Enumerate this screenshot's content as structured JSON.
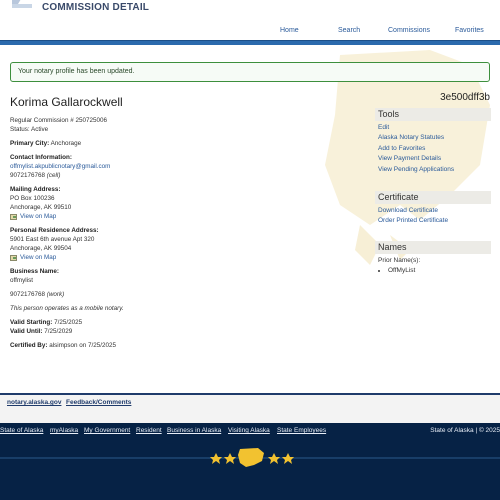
{
  "header": {
    "title": "COMMISSION DETAIL",
    "nav": [
      "Home",
      "Search",
      "Commissions",
      "Favorites"
    ]
  },
  "alert": "Your notary profile has been updated.",
  "notary": {
    "name": "Korima Gallarockwell",
    "hash": "3e500dff3b",
    "commission": "Regular Commission # 250725006",
    "status": "Status: Active",
    "primary_city_label": "Primary City:",
    "primary_city": "Anchorage",
    "contact_label": "Contact Information:",
    "email": "offmylist.akpublicnotary@gmail.com",
    "phone_cell": "9072176768",
    "cell_tag": "(cell)",
    "mailing_label": "Mailing Address:",
    "mailing_line1": "PO Box 100236",
    "mailing_line2": "Anchorage, AK 99510",
    "view_on_map": "View on Map",
    "residence_label": "Personal Residence Address:",
    "residence_line1": "5901 East 6th avenue Apt 320",
    "residence_line2": "Anchorage, AK 99504",
    "business_label": "Business Name:",
    "business_name": "offmylist",
    "phone_work": "9072176768",
    "work_tag": "(work)",
    "mobile_note": "This person operates as a mobile notary.",
    "valid_starting_label": "Valid Starting:",
    "valid_starting": "7/25/2025",
    "valid_until_label": "Valid Until:",
    "valid_until": "7/25/2029",
    "certified_label": "Certified By:",
    "certified": "alsimpson on 7/25/2025"
  },
  "tools": {
    "title": "Tools",
    "items": [
      "Edit",
      "Alaska Notary Statutes",
      "Add to Favorites",
      "View Payment Details",
      "View Pending Applications"
    ]
  },
  "certificate": {
    "title": "Certificate",
    "items": [
      "Download Certificate",
      "Order Printed Certificate"
    ]
  },
  "names": {
    "title": "Names",
    "label": "Prior Name(s):",
    "items": [
      "OffMyList"
    ]
  },
  "footer": {
    "links": [
      "notary.alaska.gov",
      "Feedback/Comments"
    ]
  },
  "state_bar": {
    "links": [
      "State of Alaska",
      "myAlaska",
      "My Government",
      "Resident",
      "Business in Alaska",
      "Visiting Alaska",
      "State Employees"
    ],
    "copyright": "State of Alaska | © 2025"
  },
  "colors": {
    "nav_bar": "#2b6aad",
    "alert_border": "#3d8f3d",
    "link": "#2a5a9a",
    "footer_bg": "#062245",
    "stars": "#f2c230"
  }
}
